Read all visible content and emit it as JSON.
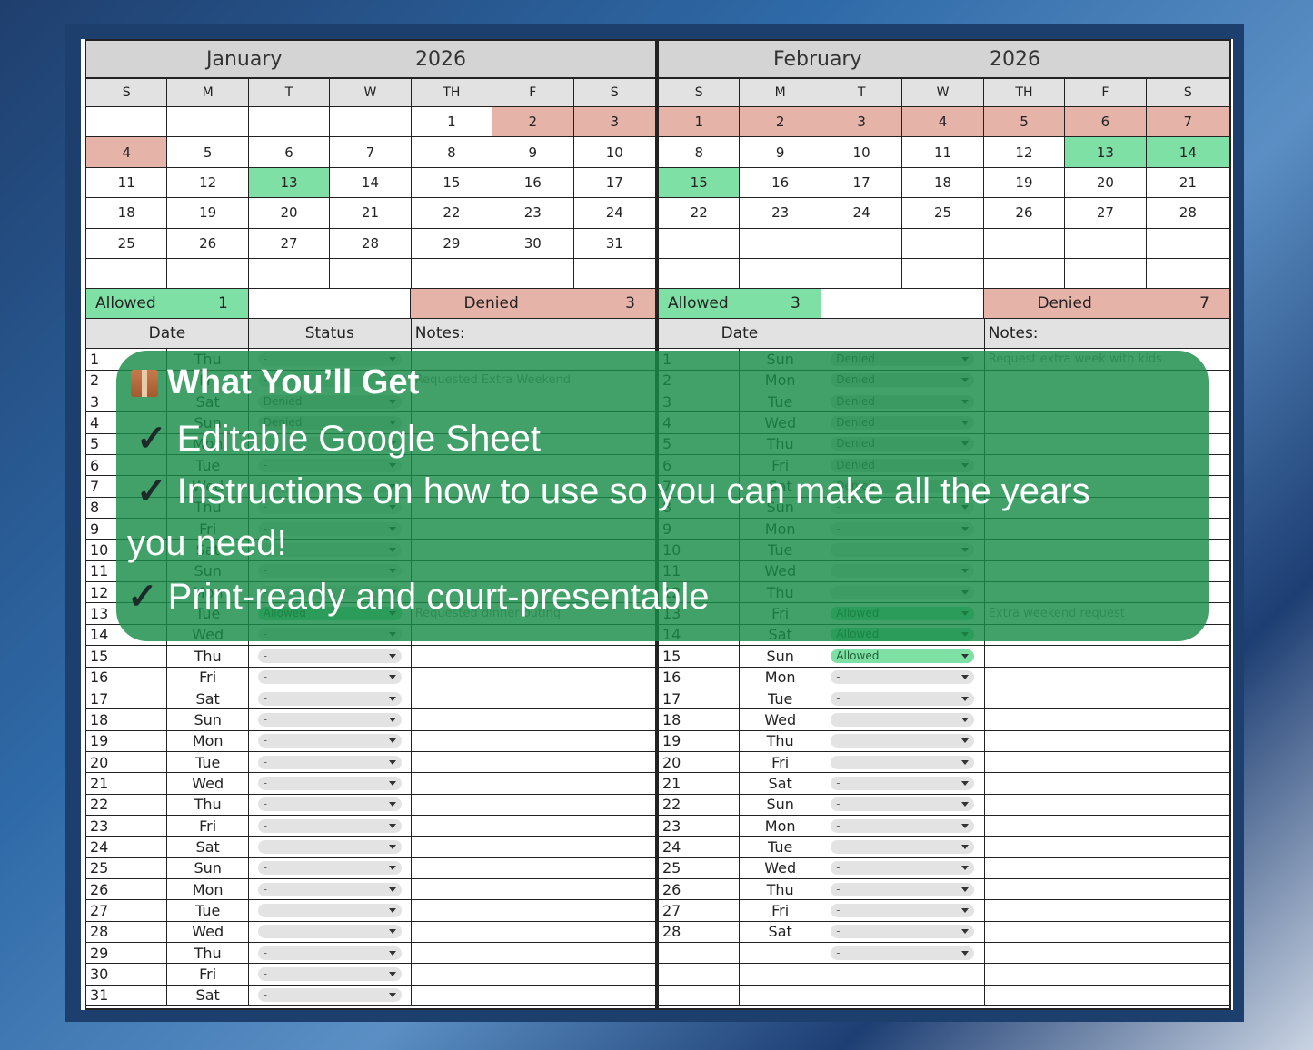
{
  "dow": [
    "S",
    "M",
    "T",
    "W",
    "TH",
    "F",
    "S"
  ],
  "january": {
    "name": "January",
    "year": "2026",
    "weeks": [
      [
        {
          "d": ""
        },
        {
          "d": ""
        },
        {
          "d": ""
        },
        {
          "d": ""
        },
        {
          "d": "1"
        },
        {
          "d": "2",
          "c": "red"
        },
        {
          "d": "3",
          "c": "red"
        }
      ],
      [
        {
          "d": "4",
          "c": "red"
        },
        {
          "d": "5"
        },
        {
          "d": "6"
        },
        {
          "d": "7"
        },
        {
          "d": "8"
        },
        {
          "d": "9"
        },
        {
          "d": "10"
        }
      ],
      [
        {
          "d": "11"
        },
        {
          "d": "12"
        },
        {
          "d": "13",
          "c": "grn"
        },
        {
          "d": "14"
        },
        {
          "d": "15"
        },
        {
          "d": "16"
        },
        {
          "d": "17"
        }
      ],
      [
        {
          "d": "18"
        },
        {
          "d": "19"
        },
        {
          "d": "20"
        },
        {
          "d": "21"
        },
        {
          "d": "22"
        },
        {
          "d": "23"
        },
        {
          "d": "24"
        }
      ],
      [
        {
          "d": "25"
        },
        {
          "d": "26"
        },
        {
          "d": "27"
        },
        {
          "d": "28"
        },
        {
          "d": "29"
        },
        {
          "d": "30"
        },
        {
          "d": "31"
        }
      ],
      [
        {
          "d": ""
        },
        {
          "d": ""
        },
        {
          "d": ""
        },
        {
          "d": ""
        },
        {
          "d": ""
        },
        {
          "d": ""
        },
        {
          "d": ""
        }
      ]
    ],
    "allowed_label": "Allowed",
    "allowed_count": "1",
    "denied_label": "Denied",
    "denied_count": "3",
    "date_header": "Date",
    "status_header": "Status",
    "notes_header": "Notes:",
    "days": [
      {
        "n": "1",
        "day": "Thu",
        "s": "-",
        "note": ""
      },
      {
        "n": "2",
        "day": "Fri",
        "s": "-",
        "note": "Requested Extra Weekend"
      },
      {
        "n": "3",
        "day": "Sat",
        "s": "Denied",
        "note": ""
      },
      {
        "n": "4",
        "day": "Sun",
        "s": "Denied",
        "note": ""
      },
      {
        "n": "5",
        "day": "Mon",
        "s": "-",
        "note": ""
      },
      {
        "n": "6",
        "day": "Tue",
        "s": "-",
        "note": ""
      },
      {
        "n": "7",
        "day": "Wed",
        "s": "-",
        "note": ""
      },
      {
        "n": "8",
        "day": "Thu",
        "s": "-",
        "note": ""
      },
      {
        "n": "9",
        "day": "Fri",
        "s": "-",
        "note": ""
      },
      {
        "n": "10",
        "day": "Sat",
        "s": "-",
        "note": ""
      },
      {
        "n": "11",
        "day": "Sun",
        "s": "-",
        "note": ""
      },
      {
        "n": "12",
        "day": "Mon",
        "s": "-",
        "note": ""
      },
      {
        "n": "13",
        "day": "Tue",
        "s": "Allowed",
        "note": "Requested dinner outing"
      },
      {
        "n": "14",
        "day": "Wed",
        "s": "-",
        "note": ""
      },
      {
        "n": "15",
        "day": "Thu",
        "s": "-",
        "note": ""
      },
      {
        "n": "16",
        "day": "Fri",
        "s": "-",
        "note": ""
      },
      {
        "n": "17",
        "day": "Sat",
        "s": "-",
        "note": ""
      },
      {
        "n": "18",
        "day": "Sun",
        "s": "-",
        "note": ""
      },
      {
        "n": "19",
        "day": "Mon",
        "s": "-",
        "note": ""
      },
      {
        "n": "20",
        "day": "Tue",
        "s": "-",
        "note": ""
      },
      {
        "n": "21",
        "day": "Wed",
        "s": "-",
        "note": ""
      },
      {
        "n": "22",
        "day": "Thu",
        "s": "-",
        "note": ""
      },
      {
        "n": "23",
        "day": "Fri",
        "s": "-",
        "note": ""
      },
      {
        "n": "24",
        "day": "Sat",
        "s": "-",
        "note": ""
      },
      {
        "n": "25",
        "day": "Sun",
        "s": "-",
        "note": ""
      },
      {
        "n": "26",
        "day": "Mon",
        "s": "-",
        "note": ""
      },
      {
        "n": "27",
        "day": "Tue",
        "s": "",
        "note": ""
      },
      {
        "n": "28",
        "day": "Wed",
        "s": "",
        "note": ""
      },
      {
        "n": "29",
        "day": "Thu",
        "s": "-",
        "note": ""
      },
      {
        "n": "30",
        "day": "Fri",
        "s": "-",
        "note": ""
      },
      {
        "n": "31",
        "day": "Sat",
        "s": "-",
        "note": ""
      }
    ]
  },
  "february": {
    "name": "February",
    "year": "2026",
    "weeks": [
      [
        {
          "d": "1",
          "c": "red"
        },
        {
          "d": "2",
          "c": "red"
        },
        {
          "d": "3",
          "c": "red"
        },
        {
          "d": "4",
          "c": "red"
        },
        {
          "d": "5",
          "c": "red"
        },
        {
          "d": "6",
          "c": "red"
        },
        {
          "d": "7",
          "c": "red"
        }
      ],
      [
        {
          "d": "8"
        },
        {
          "d": "9"
        },
        {
          "d": "10"
        },
        {
          "d": "11"
        },
        {
          "d": "12"
        },
        {
          "d": "13",
          "c": "grn"
        },
        {
          "d": "14",
          "c": "grn"
        }
      ],
      [
        {
          "d": "15",
          "c": "grn"
        },
        {
          "d": "16"
        },
        {
          "d": "17"
        },
        {
          "d": "18"
        },
        {
          "d": "19"
        },
        {
          "d": "20"
        },
        {
          "d": "21"
        }
      ],
      [
        {
          "d": "22"
        },
        {
          "d": "23"
        },
        {
          "d": "24"
        },
        {
          "d": "25"
        },
        {
          "d": "26"
        },
        {
          "d": "27"
        },
        {
          "d": "28"
        }
      ],
      [
        {
          "d": ""
        },
        {
          "d": ""
        },
        {
          "d": ""
        },
        {
          "d": ""
        },
        {
          "d": ""
        },
        {
          "d": ""
        },
        {
          "d": ""
        }
      ],
      [
        {
          "d": ""
        },
        {
          "d": ""
        },
        {
          "d": ""
        },
        {
          "d": ""
        },
        {
          "d": ""
        },
        {
          "d": ""
        },
        {
          "d": ""
        }
      ]
    ],
    "allowed_label": "Allowed",
    "allowed_count": "3",
    "denied_label": "Denied",
    "denied_count": "7",
    "date_header": "Date",
    "status_header": "",
    "notes_header": "Notes:",
    "days": [
      {
        "n": "1",
        "day": "Sun",
        "s": "Denied",
        "note": "Request extra week with kids"
      },
      {
        "n": "2",
        "day": "Mon",
        "s": "Denied",
        "note": ""
      },
      {
        "n": "3",
        "day": "Tue",
        "s": "Denied",
        "note": ""
      },
      {
        "n": "4",
        "day": "Wed",
        "s": "Denied",
        "note": ""
      },
      {
        "n": "5",
        "day": "Thu",
        "s": "Denied",
        "note": ""
      },
      {
        "n": "6",
        "day": "Fri",
        "s": "Denied",
        "note": ""
      },
      {
        "n": "7",
        "day": "Sat",
        "s": "Denied",
        "note": ""
      },
      {
        "n": "8",
        "day": "Sun",
        "s": "-",
        "note": ""
      },
      {
        "n": "9",
        "day": "Mon",
        "s": "-",
        "note": ""
      },
      {
        "n": "10",
        "day": "Tue",
        "s": "-",
        "note": ""
      },
      {
        "n": "11",
        "day": "Wed",
        "s": "",
        "note": ""
      },
      {
        "n": "12",
        "day": "Thu",
        "s": "",
        "note": ""
      },
      {
        "n": "13",
        "day": "Fri",
        "s": "Allowed",
        "note": "Extra weekend request"
      },
      {
        "n": "14",
        "day": "Sat",
        "s": "Allowed",
        "note": ""
      },
      {
        "n": "15",
        "day": "Sun",
        "s": "Allowed",
        "note": ""
      },
      {
        "n": "16",
        "day": "Mon",
        "s": "-",
        "note": ""
      },
      {
        "n": "17",
        "day": "Tue",
        "s": "-",
        "note": ""
      },
      {
        "n": "18",
        "day": "Wed",
        "s": "",
        "note": ""
      },
      {
        "n": "19",
        "day": "Thu",
        "s": "",
        "note": ""
      },
      {
        "n": "20",
        "day": "Fri",
        "s": "",
        "note": ""
      },
      {
        "n": "21",
        "day": "Sat",
        "s": "-",
        "note": ""
      },
      {
        "n": "22",
        "day": "Sun",
        "s": "-",
        "note": ""
      },
      {
        "n": "23",
        "day": "Mon",
        "s": "-",
        "note": ""
      },
      {
        "n": "24",
        "day": "Tue",
        "s": "",
        "note": ""
      },
      {
        "n": "25",
        "day": "Wed",
        "s": "-",
        "note": ""
      },
      {
        "n": "26",
        "day": "Thu",
        "s": "-",
        "note": ""
      },
      {
        "n": "27",
        "day": "Fri",
        "s": "-",
        "note": ""
      },
      {
        "n": "28",
        "day": "Sat",
        "s": "-",
        "note": ""
      },
      {
        "n": "",
        "day": "",
        "s": "-",
        "note": ""
      },
      {
        "n": "",
        "day": "",
        "s": "",
        "note": ""
      },
      {
        "n": "",
        "day": "",
        "s": "",
        "note": ""
      }
    ]
  },
  "overlay": {
    "title": "What You’ll Get",
    "title_icon": "package-icon",
    "check": "✓",
    "line1": "Editable Google Sheet",
    "line2a": "Instructions on how to use so you can make all the years",
    "line2b": "you need!",
    "line3": "Print-ready and court-presentable"
  },
  "colors": {
    "denied": "#e6b3a8",
    "allowed": "#7ee0a4",
    "overlay": "#188c48"
  }
}
